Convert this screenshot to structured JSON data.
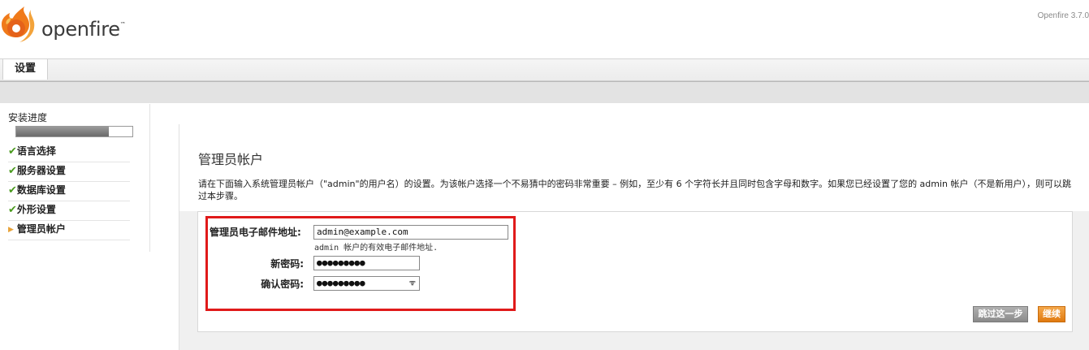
{
  "header": {
    "logo_text": "openfire",
    "logo_tm": "™",
    "version": "Openfire 3.7.0"
  },
  "tabs": [
    {
      "label": "设置",
      "active": true
    }
  ],
  "sidebar": {
    "title": "安装进度",
    "progress_percent": 80,
    "items": [
      {
        "label": "语言选择",
        "status": "done"
      },
      {
        "label": "服务器设置",
        "status": "done"
      },
      {
        "label": "数据库设置",
        "status": "done"
      },
      {
        "label": "外形设置",
        "status": "done"
      },
      {
        "label": "管理员帐户",
        "status": "current"
      }
    ],
    "check_glyph": "✔",
    "arrow_glyph": "▶"
  },
  "main": {
    "title": "管理员帐户",
    "description": "请在下面输入系统管理员帐户（\"admin\"的用户名）的设置。为该帐户选择一个不易猜中的密码非常重要 – 例如，至少有 6 个字符长并且同时包含字母和数字。如果您已经设置了您的 admin 帐户（不是新用户），则可以跳过本步骤。",
    "form": {
      "email_label": "管理员电子邮件地址:",
      "email_value": "admin@example.com",
      "email_help": "admin 帐户的有效电子邮件地址.",
      "password_label": "新密码:",
      "password_value": "●●●●●●●●●",
      "confirm_label": "确认密码:",
      "confirm_value": "●●●●●●●●●"
    },
    "buttons": {
      "skip": "跳过这一步",
      "continue": "继续"
    }
  },
  "colors": {
    "highlight_border": "#e01a1a",
    "check_green": "#4a9a1e",
    "continue_orange": "#e8891a",
    "skip_gray": "#9a9a9a"
  }
}
